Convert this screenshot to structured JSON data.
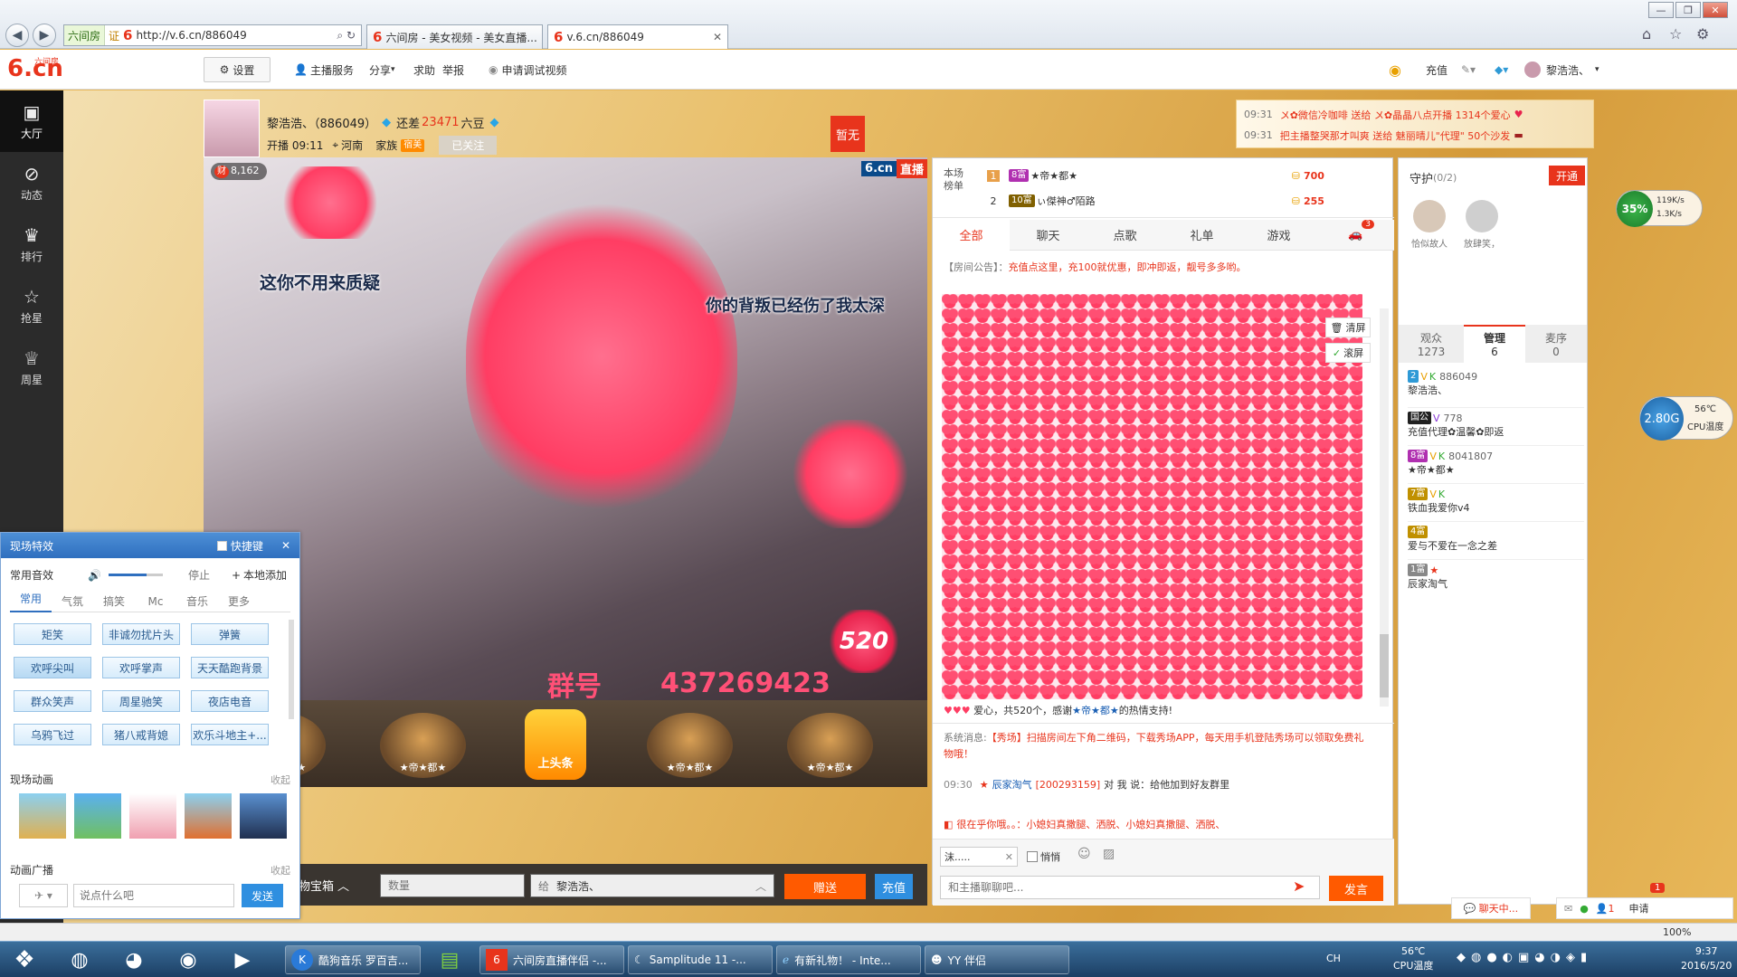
{
  "browser": {
    "address_site": "六间房",
    "address_cert": "证",
    "address_url": "http://v.6.cn/886049",
    "tabs": [
      "六间房 - 美女视频 - 美女直播...",
      "v.6.cn/886049"
    ],
    "tab_icon": "6"
  },
  "header": {
    "logo_main": "6.cn",
    "logo_sub": "六间房",
    "settings": "设置",
    "anchor_service": "主播服务",
    "share": "分享",
    "help": "求助",
    "report": "举报",
    "apply_debug": "申请调试视频",
    "recharge": "充值",
    "username": "黎浩浩、"
  },
  "leftnav": [
    {
      "label": "大厅",
      "icon": "tv-icon"
    },
    {
      "label": "动态",
      "icon": "compass-icon"
    },
    {
      "label": "排行",
      "icon": "crown-icon"
    },
    {
      "label": "抢星",
      "icon": "star-icon"
    },
    {
      "label": "周星",
      "icon": "cup-icon"
    }
  ],
  "anchor": {
    "name": "黎浩浩、（886049）",
    "still_short": "还差",
    "short_amount": "23471",
    "short_unit": "六豆",
    "start_time": "开播 09:11",
    "location": "河南",
    "family": "家族",
    "family_badge": "宿美",
    "follow": "已关注",
    "no_seat": "暂无",
    "fortune": "8,162",
    "brand": "6.cn",
    "live": "直播"
  },
  "video": {
    "overlay_1": "这你不用来质疑",
    "overlay_2": "你的背叛已经伤了我太深",
    "group_label": "群号",
    "group_number": "437269423",
    "gift_520": "520"
  },
  "giftrow": {
    "items": [
      "★帝★都★",
      "★帝★都★",
      "上头条",
      "★帝★都★",
      "★帝★都★"
    ]
  },
  "bottombar": {
    "treasure": "物宝箱",
    "qty_placeholder": "数量",
    "to_label": "给",
    "to_user": "黎浩浩、",
    "send_gift": "赠送",
    "recharge": "充值"
  },
  "ranking": {
    "title_1": "本场",
    "title_2": "榜单",
    "rows": [
      {
        "rank": "1",
        "name": "★帝★都★",
        "score": "700"
      },
      {
        "rank": "2",
        "name": "ぃ傑神♂陌路",
        "score": "255"
      }
    ]
  },
  "chattabs": [
    "全部",
    "聊天",
    "点歌",
    "礼单",
    "游戏"
  ],
  "chattab_badge": "3",
  "announcement": {
    "label": "【房间公告】：",
    "text": "充值点这里，充100就优惠，即冲即返，靓号多多哟。"
  },
  "chat": {
    "clear": "清屏",
    "scroll": "滚屏",
    "heart_msg_prefix": "爱心，共520个，感谢",
    "heart_msg_user": "★帝★都★",
    "heart_msg_suffix": "的热情支持!",
    "sys_label": "系统消息:",
    "sys_text": "【秀场】扫描房间左下角二维码，下载秀场APP，每天用手机登陆秀场可以领取免费礼物哦！",
    "msg_time": "09:30",
    "msg_user": "辰家淘气",
    "msg_id": "[200293159]",
    "msg_to": "对 我 说：",
    "msg_text": "给他加到好友群里",
    "marquee": "很在乎你哦。。：小媳妇真撒腿、洒脱、小媳妇真撒腿、洒脱、",
    "target": "沫.....",
    "private": "悄悄",
    "input_placeholder": "和主播聊聊吧...",
    "send": "发言"
  },
  "broadcast": [
    {
      "time": "09:31",
      "text": "〤✿微信冷咖啡 送给 〤✿晶晶八点开播 1314个爱心"
    },
    {
      "time": "09:31",
      "text": "把主播整哭那才叫爽 送给 魅丽晴儿\"代理\" 50个沙发"
    }
  ],
  "guard": {
    "title": "守护",
    "count": "(0/2)",
    "open": "开通",
    "members": [
      "恰似故人",
      "放肆笑，"
    ]
  },
  "usertabs": [
    {
      "label": "观众",
      "count": "1273"
    },
    {
      "label": "管理",
      "count": "6"
    },
    {
      "label": "麦序",
      "count": "0"
    }
  ],
  "admins": [
    {
      "id": "886049",
      "name": "黎浩浩、",
      "badge": "2"
    },
    {
      "id": "778",
      "name": "充值代理✿温馨✿即返",
      "badge": "国公"
    },
    {
      "id": "8041807",
      "name": "★帝★都★",
      "badge": "8富"
    },
    {
      "id": "",
      "name": "铁血我爱你v4",
      "badge": "7富"
    },
    {
      "id": "",
      "name": "爱与不爱在一念之差",
      "badge": "4富"
    },
    {
      "id": "",
      "name": "辰家淘气",
      "badge": "1富"
    }
  ],
  "widgets": {
    "net_percent": "35%",
    "up_speed": "119K/s",
    "down_speed": "1.3K/s",
    "mem": "2.80G",
    "cpu_temp": "56℃",
    "cpu_label": "CPU温度"
  },
  "fxpanel": {
    "title": "现场特效",
    "hotkey": "快捷键",
    "sound_label": "常用音效",
    "stop": "停止",
    "add_local": "本地添加",
    "tabs": [
      "常用",
      "气氛",
      "搞笑",
      "Mc",
      "音乐",
      "更多"
    ],
    "buttons": [
      "矩笑",
      "非诚勿扰片头",
      "弹簧",
      "欢呼尖叫",
      "欢呼掌声",
      "天天酷跑背景",
      "群众笑声",
      "周星驰笑",
      "夜店电音",
      "乌鸦飞过",
      "猪八戒背媳",
      "欢乐斗地主+..."
    ],
    "anim_label": "现场动画",
    "collapse": "收起",
    "broadcast_label": "动画广播",
    "input_placeholder": "说点什么吧",
    "send": "发送"
  },
  "footer": {
    "chatting": "聊天中...",
    "apply": "申请",
    "apply_badge": "1",
    "zoom": "100%"
  },
  "taskbar": {
    "items": [
      "酷狗音乐 罗百吉...",
      "六间房直播伴侣 -...",
      "Samplitude 11 -...",
      "有新礼物！ - Inte...",
      "YY 伴侣"
    ],
    "temp": "56℃",
    "temp_label": "CPU温度",
    "time": "9:37",
    "date": "2016/5/20",
    "lang": "CH"
  },
  "colors": {
    "accent": "#e8341c",
    "orange": "#ff5a00",
    "blue": "#2f6fbf"
  }
}
